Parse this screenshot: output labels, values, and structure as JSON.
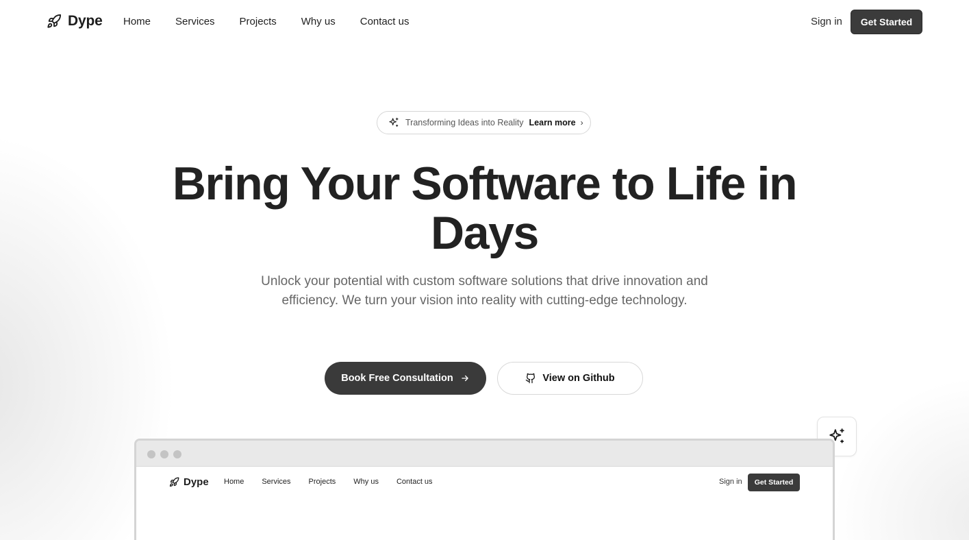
{
  "brand": {
    "name": "Dype",
    "icon": "rocket-icon"
  },
  "nav": {
    "links": [
      "Home",
      "Services",
      "Projects",
      "Why us",
      "Contact us"
    ],
    "signin": "Sign in",
    "cta": "Get Started"
  },
  "badge": {
    "icon": "sparkles-icon",
    "text": "Transforming Ideas into Reality",
    "link": "Learn more",
    "chevron": "›"
  },
  "hero": {
    "title_line1": "Bring Your Software to Life in",
    "title_line2": "Days",
    "subtitle": "Unlock your potential with custom software solutions that drive innovation and efficiency. We turn your vision into reality with cutting-edge technology.",
    "primary_cta": "Book Free Consultation",
    "primary_cta_icon": "arrow-right-icon",
    "secondary_cta": "View on Github",
    "secondary_cta_icon": "github-icon"
  },
  "floating_button": {
    "icon": "sparkles-icon"
  },
  "preview": {
    "brand": "Dype",
    "links": [
      "Home",
      "Services",
      "Projects",
      "Why us",
      "Contact us"
    ],
    "signin": "Sign in",
    "cta": "Get Started"
  },
  "colors": {
    "primary_dark": "#3a3a3a",
    "text": "#222222",
    "muted_text": "#666666",
    "border": "#d6d6d6"
  }
}
